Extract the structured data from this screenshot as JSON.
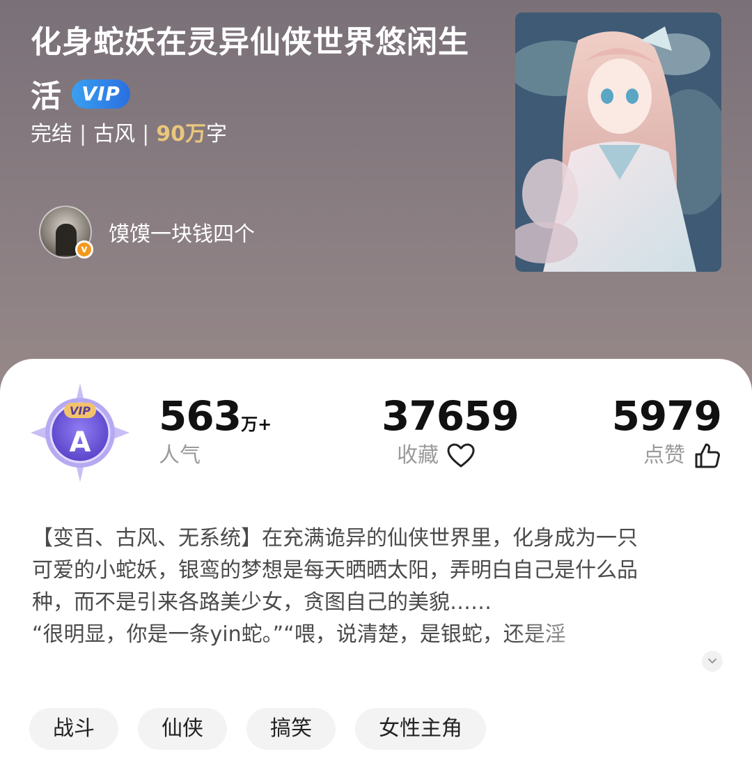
{
  "book": {
    "title": "化身蛇妖在灵异仙侠世界悠闲生活",
    "vip_label": "VIP",
    "status": "完结",
    "genre": "古风",
    "word_count": "90万",
    "word_unit": "字",
    "separator": "|"
  },
  "author": {
    "name": "馍馍一块钱四个",
    "verified_mark": "v"
  },
  "level_badge": {
    "vip_text": "VIP",
    "grade": "A"
  },
  "stats": {
    "popularity": {
      "value": "563",
      "unit": "万+",
      "label": "人气"
    },
    "favorites": {
      "value": "37659",
      "label": "收藏"
    },
    "likes": {
      "value": "5979",
      "label": "点赞"
    }
  },
  "description": {
    "line1": "【变百、古风、无系统】在充满诡异的仙侠世界里，化身成为一只",
    "line2": "可爱的小蛇妖，银鸾的梦想是每天晒晒太阳，弄明白自己是什么品",
    "line3": "种，而不是引来各路美少女，贪图自己的美貌……",
    "line4": "“很明显，你是一条yin蛇。”“喂，说清楚，是银蛇，还是淫"
  },
  "tags": [
    "战斗",
    "仙侠",
    "搞笑",
    "女性主角"
  ],
  "icons": {
    "favorite": "heart-outline-icon",
    "like": "thumbs-up-icon",
    "expand": "chevron-down-icon"
  }
}
